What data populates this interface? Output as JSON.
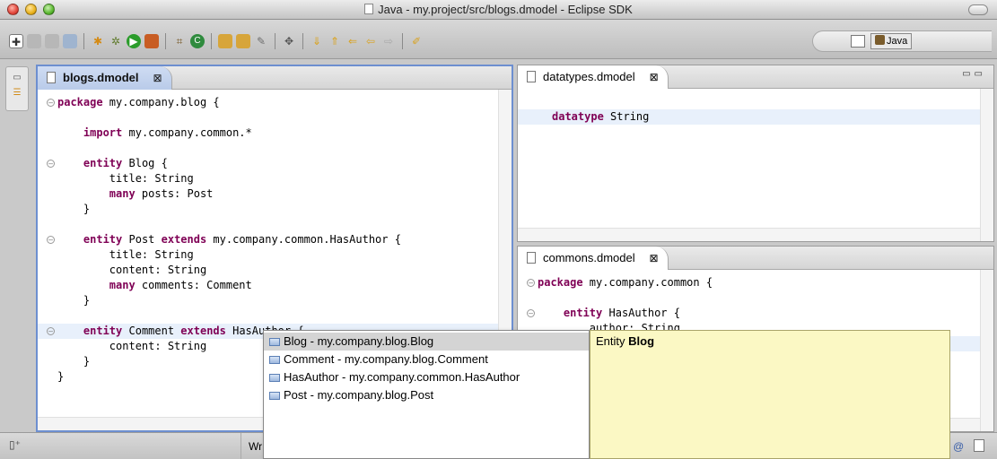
{
  "window": {
    "title": "Java - my.project/src/blogs.dmodel - Eclipse SDK"
  },
  "perspective": {
    "label": "Java"
  },
  "editors": {
    "blogs": {
      "tab_label": "blogs.dmodel",
      "close_glyph": "⊠",
      "lines": [
        {
          "indent": "",
          "parts": [
            [
              "kw",
              "package"
            ],
            [
              "t",
              " my.company.blog {"
            ]
          ],
          "fold": "⊖"
        },
        {
          "indent": "",
          "parts": [
            [
              "t",
              ""
            ]
          ]
        },
        {
          "indent": "    ",
          "parts": [
            [
              "kw",
              "import"
            ],
            [
              "t",
              " my.company.common.*"
            ]
          ]
        },
        {
          "indent": "",
          "parts": [
            [
              "t",
              ""
            ]
          ]
        },
        {
          "indent": "    ",
          "parts": [
            [
              "kw",
              "entity"
            ],
            [
              "t",
              " Blog {"
            ]
          ],
          "fold": "⊖"
        },
        {
          "indent": "        ",
          "parts": [
            [
              "t",
              "title: String"
            ]
          ]
        },
        {
          "indent": "        ",
          "parts": [
            [
              "kw",
              "many"
            ],
            [
              "t",
              " posts: Post"
            ]
          ]
        },
        {
          "indent": "    ",
          "parts": [
            [
              "t",
              "}"
            ]
          ]
        },
        {
          "indent": "",
          "parts": [
            [
              "t",
              ""
            ]
          ]
        },
        {
          "indent": "    ",
          "parts": [
            [
              "kw",
              "entity"
            ],
            [
              "t",
              " Post "
            ],
            [
              "kw",
              "extends"
            ],
            [
              "t",
              " my.company.common.HasAuthor {"
            ]
          ],
          "fold": "⊖"
        },
        {
          "indent": "        ",
          "parts": [
            [
              "t",
              "title: String"
            ]
          ]
        },
        {
          "indent": "        ",
          "parts": [
            [
              "t",
              "content: String"
            ]
          ]
        },
        {
          "indent": "        ",
          "parts": [
            [
              "kw",
              "many"
            ],
            [
              "t",
              " comments: Comment"
            ]
          ]
        },
        {
          "indent": "    ",
          "parts": [
            [
              "t",
              "}"
            ]
          ]
        },
        {
          "indent": "",
          "parts": [
            [
              "t",
              ""
            ]
          ]
        },
        {
          "indent": "    ",
          "parts": [
            [
              "kw",
              "entity"
            ],
            [
              "t",
              " Comment "
            ],
            [
              "kw",
              "extends"
            ],
            [
              "t",
              " HasAuthor {"
            ]
          ],
          "fold": "⊖",
          "current": true
        },
        {
          "indent": "        ",
          "parts": [
            [
              "t",
              "content: String"
            ]
          ]
        },
        {
          "indent": "    ",
          "parts": [
            [
              "t",
              "}"
            ]
          ]
        },
        {
          "indent": "",
          "parts": [
            [
              "t",
              "}"
            ]
          ]
        }
      ]
    },
    "datatypes": {
      "tab_label": "datatypes.dmodel",
      "close_glyph": "⊠",
      "lines": [
        {
          "indent": "",
          "parts": [
            [
              "t",
              ""
            ]
          ]
        },
        {
          "indent": "",
          "parts": [
            [
              "kw",
              "datatype"
            ],
            [
              "t",
              " String"
            ]
          ],
          "current": true
        }
      ]
    },
    "commons": {
      "tab_label": "commons.dmodel",
      "close_glyph": "⊠",
      "lines": [
        {
          "indent": "",
          "parts": [
            [
              "kw",
              "package"
            ],
            [
              "t",
              " my.company.common {"
            ]
          ],
          "fold": "⊖"
        },
        {
          "indent": "",
          "parts": [
            [
              "t",
              ""
            ]
          ]
        },
        {
          "indent": "    ",
          "parts": [
            [
              "kw",
              "entity"
            ],
            [
              "t",
              " HasAuthor {"
            ]
          ],
          "fold": "⊖"
        },
        {
          "indent": "        ",
          "parts": [
            [
              "t",
              "author: String"
            ]
          ]
        },
        {
          "indent": "",
          "parts": [
            [
              "t",
              ""
            ]
          ],
          "current": true
        }
      ]
    }
  },
  "content_assist": {
    "items": [
      {
        "label": "Blog - my.company.blog.Blog",
        "selected": true
      },
      {
        "label": "Comment - my.company.blog.Comment"
      },
      {
        "label": "HasAuthor - my.company.common.HasAuthor"
      },
      {
        "label": "Post - my.company.blog.Post"
      }
    ],
    "doc_prefix": "Entity ",
    "doc_name": "Blog"
  },
  "status": {
    "writable": "Wr"
  },
  "icons": [
    "new-icon",
    "save-icon",
    "print-icon",
    "debug-icon",
    "run-icon",
    "search-icon",
    "perspective-icon",
    "java-perspective-icon",
    "problems-icon",
    "tasks-icon"
  ]
}
